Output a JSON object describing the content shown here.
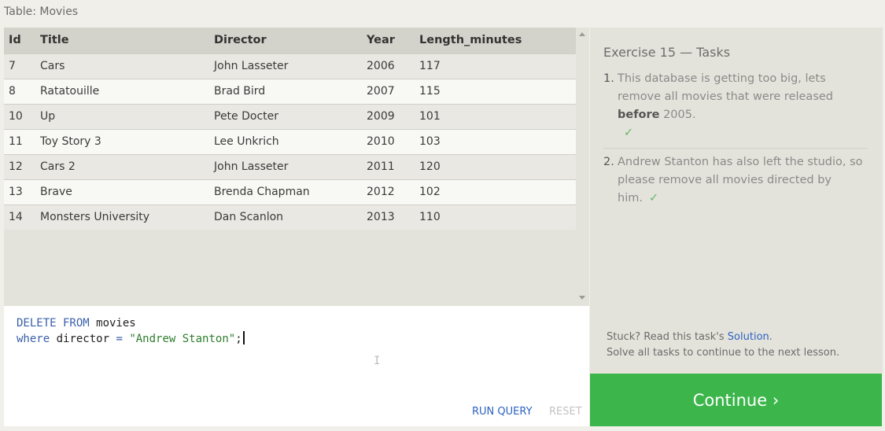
{
  "table": {
    "caption": "Table: Movies",
    "columns": [
      "Id",
      "Title",
      "Director",
      "Year",
      "Length_minutes"
    ],
    "rows": [
      [
        "7",
        "Cars",
        "John Lasseter",
        "2006",
        "117"
      ],
      [
        "8",
        "Ratatouille",
        "Brad Bird",
        "2007",
        "115"
      ],
      [
        "10",
        "Up",
        "Pete Docter",
        "2009",
        "101"
      ],
      [
        "11",
        "Toy Story 3",
        "Lee Unkrich",
        "2010",
        "103"
      ],
      [
        "12",
        "Cars 2",
        "John Lasseter",
        "2011",
        "120"
      ],
      [
        "13",
        "Brave",
        "Brenda Chapman",
        "2012",
        "102"
      ],
      [
        "14",
        "Monsters University",
        "Dan Scanlon",
        "2013",
        "110"
      ]
    ]
  },
  "editor": {
    "line1_kw": "DELETE FROM",
    "line1_rest": " movies",
    "line2_kw": "where",
    "line2_mid": " director ",
    "line2_op": "=",
    "line2_str": "\"Andrew Stanton\"",
    "line2_end": ";",
    "run_label": "RUN QUERY",
    "reset_label": "RESET"
  },
  "tasks": {
    "title": "Exercise 15 — Tasks",
    "items": [
      {
        "num": "1.",
        "before": "This database is getting too big, lets remove all movies that were released ",
        "bold": "before",
        "after": " 2005.",
        "check": "✓"
      },
      {
        "num": "2.",
        "text": "Andrew Stanton has also left the studio, so please remove all movies directed by him.",
        "check": "✓"
      }
    ],
    "help_prefix": "Stuck? Read this task's ",
    "help_link": "Solution",
    "help_suffix": ".",
    "help_line2": "Solve all tasks to continue to the next lesson.",
    "continue_label": "Continue ›"
  }
}
